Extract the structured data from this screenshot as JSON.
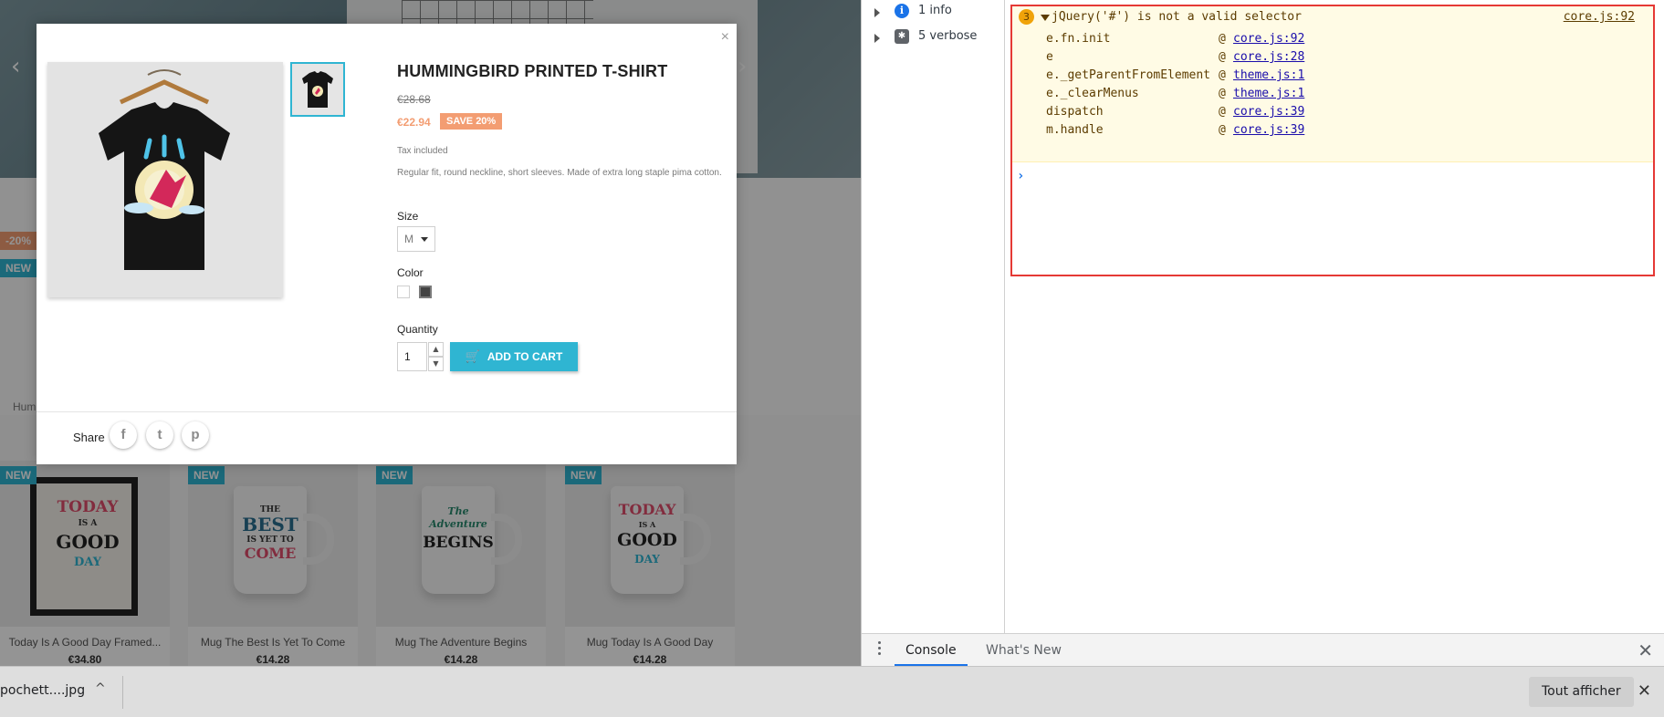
{
  "shop": {
    "hero_prev": "‹",
    "hero_next": "›",
    "bg_discount_badge": "-20%",
    "bg_new_badge": "NEW",
    "bg_product_label": "Hum",
    "products": [
      {
        "badge": "NEW",
        "name": "Today Is A Good Day Framed...",
        "price": "€34.80",
        "art": [
          "TODAY",
          "IS A",
          "GOOD",
          "DAY"
        ]
      },
      {
        "badge": "NEW",
        "name": "Mug The Best Is Yet To Come",
        "price": "€14.28",
        "art": [
          "THE",
          "BEST",
          "IS YET TO",
          "COME"
        ]
      },
      {
        "badge": "NEW",
        "name": "Mug The Adventure Begins",
        "price": "€14.28",
        "art": [
          "The",
          "Adventure",
          "BEGINS"
        ]
      },
      {
        "badge": "NEW",
        "name": "Mug Today Is A Good Day",
        "price": "€14.28",
        "art": [
          "TODAY",
          "IS A",
          "GOOD",
          "DAY"
        ]
      }
    ]
  },
  "modal": {
    "close": "×",
    "title": "HUMMINGBIRD PRINTED T-SHIRT",
    "regular_price": "€28.68",
    "price": "€22.94",
    "discount": "SAVE 20%",
    "tax": "Tax included",
    "description": "Regular fit, round neckline, short sleeves. Made of extra long staple pima cotton.",
    "size_label": "Size",
    "size_value": "M",
    "color_label": "Color",
    "colors": [
      "#ffffff",
      "#434343"
    ],
    "quantity_label": "Quantity",
    "quantity_value": "1",
    "add_to_cart": "ADD TO CART",
    "share_label": "Share",
    "share_icons": [
      "f",
      "t",
      "p"
    ]
  },
  "devtools": {
    "sidebar": [
      {
        "label": "1 info",
        "icon": "info-icon"
      },
      {
        "label": "5 verbose",
        "icon": "bug-icon"
      }
    ],
    "warning": {
      "count": "3",
      "message": "jQuery('#') is not a valid selector",
      "source": "core.js:92",
      "stack": [
        {
          "fn": "e.fn.init",
          "src": "core.js:92"
        },
        {
          "fn": "e",
          "src": "core.js:28"
        },
        {
          "fn": "e._getParentFromElement",
          "src": "theme.js:1"
        },
        {
          "fn": "e._clearMenus",
          "src": "theme.js:1"
        },
        {
          "fn": "dispatch",
          "src": "core.js:39"
        },
        {
          "fn": "m.handle",
          "src": "core.js:39"
        }
      ],
      "at": "@"
    },
    "prompt": "›",
    "drawer_tabs": [
      "Console",
      "What's New"
    ],
    "drawer_close": "✕",
    "accent": "#1a73e8",
    "warning_bg": "#fffbe5",
    "error_outline": "#e53935"
  },
  "download_bar": {
    "file": "pochett....jpg",
    "chevron": "^",
    "show_all": "Tout afficher",
    "close": "✕"
  }
}
